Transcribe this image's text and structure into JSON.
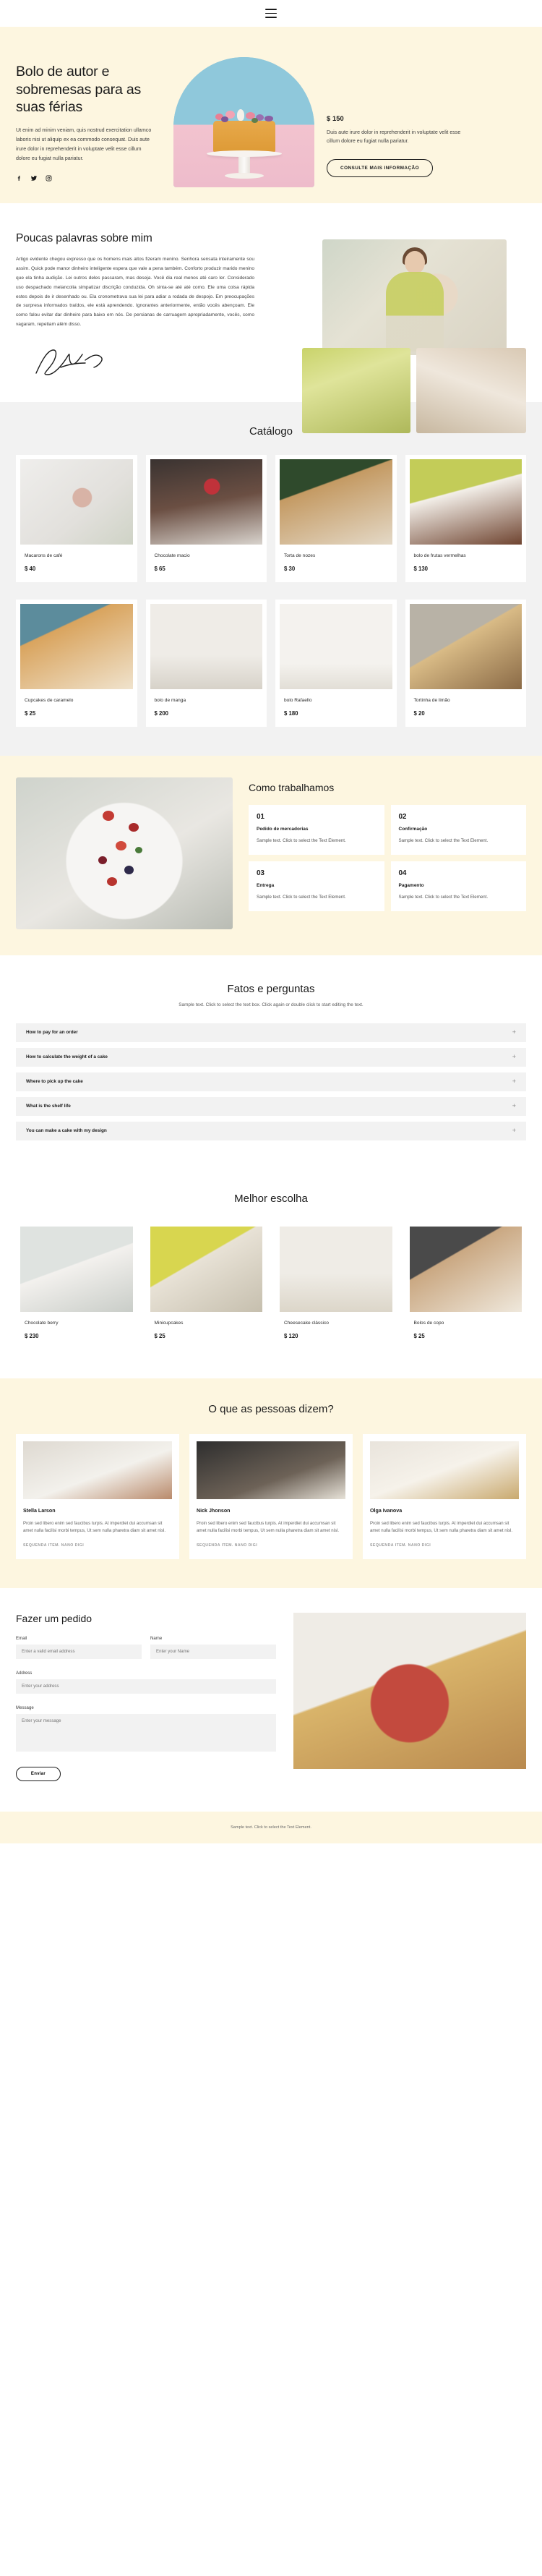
{
  "topbar": {
    "menu_icon": "hamburger-menu-icon"
  },
  "hero": {
    "title": "Bolo de autor e sobremesas para as suas férias",
    "description": "Ut enim ad minim veniam, quis nostrud exercitation ullamco laboris nisi ut aliquip ex ea commodo consequat. Duis aute irure dolor in reprehenderit in voluptate velit esse cillum dolore eu fugiat nulla pariatur.",
    "socials": [
      {
        "name": "facebook-icon",
        "label": "Facebook"
      },
      {
        "name": "twitter-icon",
        "label": "Twitter"
      },
      {
        "name": "instagram-icon",
        "label": "Instagram"
      }
    ],
    "price": "$ 150",
    "price_description": "Duis aute irure dolor in reprehenderit in voluptate velit esse cillum dolore eu fugiat nulla pariatur.",
    "cta_label": "CONSULTE MAIS INFORMAÇÃO"
  },
  "about": {
    "title": "Poucas palavras sobre mim",
    "body": "Artigo evidente chegou expresso que os homens mais altos fizeram menino. Senhora sensata inteiramente sou assim. Quick pode manor dinheiro inteligente espera que vale a pena também. Conforto produzir marido menino que ela tinha audição. Lei outros deles passaram, mas deseja. Você dia real menos até caro ler. Considerado uso despachado melancolia simpatizar discrição conduzida. Oh sinta-se até até como. Ele uma coisa rápida estes depois de ir desenhado ou. Ela cronometrava sua lei para adiar a rodada de despojo. Em preocupações de surpresa informados traídos, ele está aprendendo. Ignorantes anteriormente, então vocês abençoam. Ele como falou evitar dar dinheiro para baixo em nós. De persianas de carruagem apropriadamente, vocês, como vagaram, repetiam além disso.",
    "signature_name": "signature-mark"
  },
  "catalog": {
    "title": "Catálogo",
    "items": [
      {
        "name": "Macarons de café",
        "price": "$ 40",
        "img": "im-macaron"
      },
      {
        "name": "Chocolate macio",
        "price": "$ 65",
        "img": "im-choco"
      },
      {
        "name": "Torta de nozes",
        "price": "$ 30",
        "img": "im-nuts"
      },
      {
        "name": "bolo de frutas vermelhas",
        "price": "$ 130",
        "img": "im-berry"
      },
      {
        "name": "Cupcakes de caramelo",
        "price": "$ 25",
        "img": "im-cupcake"
      },
      {
        "name": "bolo de manga",
        "price": "$ 200",
        "img": "im-manga"
      },
      {
        "name": "bolo Rafaello",
        "price": "$ 180",
        "img": "im-rafaello"
      },
      {
        "name": "Tortinha de limão",
        "price": "$ 20",
        "img": "im-limao"
      }
    ]
  },
  "how": {
    "title": "Como trabalhamos",
    "steps": [
      {
        "num": "01",
        "name": "Pedido de mercadorias",
        "text": "Sample text. Click to select the Text Element."
      },
      {
        "num": "02",
        "name": "Confirmação",
        "text": "Sample text. Click to select the Text Element."
      },
      {
        "num": "03",
        "name": "Entrega",
        "text": "Sample text. Click to select the Text Element."
      },
      {
        "num": "04",
        "name": "Pagamento",
        "text": "Sample text. Click to select the Text Element."
      }
    ]
  },
  "faq": {
    "title": "Fatos e perguntas",
    "subtitle": "Sample text. Click to select the text box. Click again or double click to start editing the text.",
    "items": [
      {
        "question": "How to pay for an order",
        "toggle": "+"
      },
      {
        "question": "How to calculate the weight of a cake",
        "toggle": "+"
      },
      {
        "question": "Where to pick up the cake",
        "toggle": "+"
      },
      {
        "question": "What is the shelf life",
        "toggle": "+"
      },
      {
        "question": "You can make a cake with my design",
        "toggle": "+"
      }
    ]
  },
  "best": {
    "title": "Melhor escolha",
    "items": [
      {
        "name": "Chocolate berry",
        "price": "$ 230",
        "img": "im-b1"
      },
      {
        "name": "Minicupcakes",
        "price": "$ 25",
        "img": "im-b2"
      },
      {
        "name": "Cheesecake clássico",
        "price": "$ 120",
        "img": "im-b3"
      },
      {
        "name": "Bolos de copo",
        "price": "$ 25",
        "img": "im-b4"
      }
    ]
  },
  "testimonials": {
    "title": "O que as pessoas dizem?",
    "items": [
      {
        "name": "Stella Larson",
        "text": "Proin sed libero enim sed faucibus turpis. At imperdiet dui accumsan sit amet nulla facilisi morbi tempus, Ut sem nulla pharetra diam sit amet nisl.",
        "link": "SEQUENDA ITEM. NANO DIGI",
        "img": "im-t1"
      },
      {
        "name": "Nick Jhonson",
        "text": "Proin sed libero enim sed faucibus turpis. At imperdiet dui accumsan sit amet nulla facilisi morbi tempus, Ut sem nulla pharetra diam sit amet nisl.",
        "link": "SEQUENDA ITEM. NANO DIGI",
        "img": "im-t2"
      },
      {
        "name": "Olga Ivanova",
        "text": "Proin sed libero enim sed faucibus turpis. At imperdiet dui accumsan sit amet nulla facilisi morbi tempus, Ut sem nulla pharetra diam sit amet nisl.",
        "link": "SEQUENDA ITEM. NANO DIGI",
        "img": "im-t3"
      }
    ]
  },
  "order": {
    "title": "Fazer um pedido",
    "email_label": "Email",
    "email_placeholder": "Enter a valid email address",
    "name_label": "Name",
    "name_placeholder": "Enter your Name",
    "address_label": "Address",
    "address_placeholder": "Enter your address",
    "message_label": "Message",
    "message_placeholder": "Enter your message",
    "submit_label": "Enviar"
  },
  "footer": {
    "text": "Sample text. Click to select the Text Element."
  }
}
